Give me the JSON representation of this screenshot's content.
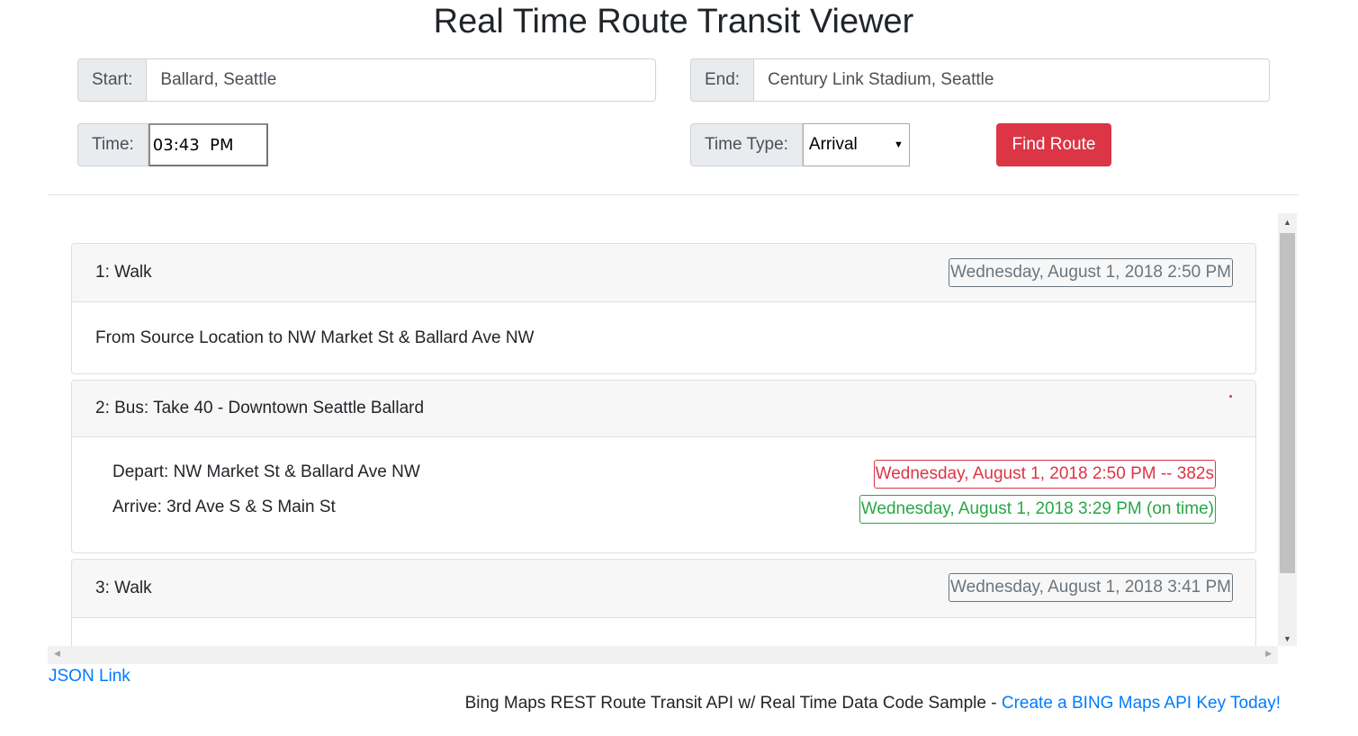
{
  "page": {
    "title": "Real Time Route Transit Viewer"
  },
  "form": {
    "start_label": "Start:",
    "start_value": "Ballard, Seattle",
    "end_label": "End:",
    "end_value": "Century Link Stadium, Seattle",
    "time_label": "Time:",
    "time_value": "03:43  PM",
    "time_type_label": "Time Type:",
    "time_type_value": "Arrival",
    "find_route_label": "Find Route"
  },
  "legs": [
    {
      "header": "1: Walk",
      "time": "Wednesday, August 1, 2018 2:50 PM",
      "description": "From Source Location to NW Market St & Ballard Ave NW"
    },
    {
      "header": "2: Bus: Take 40 - Downtown Seattle Ballard",
      "depart": "Depart: NW Market St & Ballard Ave NW",
      "depart_time": "Wednesday, August 1, 2018 2:50 PM -- 382s",
      "arrive": "Arrive: 3rd Ave S & S Main St",
      "arrive_time": "Wednesday, August 1, 2018 3:29 PM (on time)"
    },
    {
      "header": "3: Walk",
      "time": "Wednesday, August 1, 2018 3:41 PM"
    }
  ],
  "links": {
    "json_link": "JSON Link",
    "footer_text": "Bing Maps REST Route Transit API w/ Real Time Data Code Sample - ",
    "footer_link": "Create a BING Maps API Key Today!"
  },
  "colors": {
    "danger": "#dc3545",
    "success": "#28a745",
    "secondary": "#6c757d",
    "link": "#007bff"
  },
  "icons": {
    "select_arrow": "triangle-down-icon",
    "scroll_up": "triangle-up-icon",
    "scroll_down": "triangle-down-icon",
    "scroll_left": "triangle-left-icon",
    "scroll_right": "triangle-right-icon"
  }
}
